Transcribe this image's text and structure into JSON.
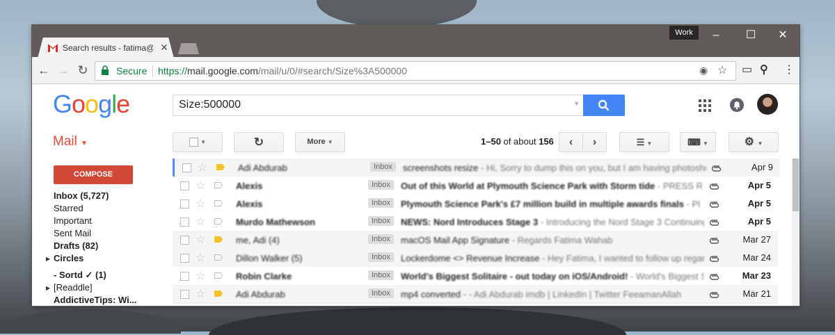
{
  "browser": {
    "profile_badge": "Work",
    "tab_title": "Search results - fatima@",
    "secure_label": "Secure",
    "url_scheme": "https://",
    "url_host": "mail.google.com",
    "url_path": "/mail/u/0/#search/Size%3A500000"
  },
  "gmail": {
    "logo": "Google",
    "search_value": "Size:500000",
    "mail_label": "Mail",
    "compose_label": "COMPOSE",
    "more_label": "More",
    "pager_range": "1–50",
    "pager_of": "of about",
    "pager_total": "156"
  },
  "sidebar": {
    "items": [
      {
        "label": "Inbox (5,727)",
        "bold": true
      },
      {
        "label": "Starred",
        "bold": false
      },
      {
        "label": "Important",
        "bold": false
      },
      {
        "label": "Sent Mail",
        "bold": false
      },
      {
        "label": "Drafts (82)",
        "bold": true
      },
      {
        "label": "Circles",
        "bold": true
      },
      {
        "label": "- Sortd ✓ (1)",
        "bold": true
      },
      {
        "label": "[Readdle]",
        "bold": false
      },
      {
        "label": "AddictiveTips: Wi...",
        "bold": true
      }
    ]
  },
  "emails": [
    {
      "sender": "Adi Abdurab",
      "label": "Inbox",
      "subject": "screenshots resize",
      "snippet": " - Hi, Sorry to dump this on you, but I am having photosho",
      "date": "Apr 9",
      "unread": false,
      "important": true
    },
    {
      "sender": "Alexis",
      "label": "Inbox",
      "subject": "Out of this World at Plymouth Science Park with Storm tide",
      "snippet": " - PRESS R",
      "date": "Apr 5",
      "unread": true,
      "important": false
    },
    {
      "sender": "Alexis",
      "label": "Inbox",
      "subject": "Plymouth Science Park's £7 million build in multiple awards finals",
      "snippet": " - Pl",
      "date": "Apr 5",
      "unread": true,
      "important": false
    },
    {
      "sender": "Murdo Mathewson",
      "label": "Inbox",
      "subject": "NEWS: Nord Introduces Stage 3",
      "snippet": " - Introducing the Nord Stage 3 Continuing",
      "date": "Apr 5",
      "unread": true,
      "important": false
    },
    {
      "sender": "me, Adi (4)",
      "label": "Inbox",
      "subject": "macOS Mail App Signature",
      "snippet": " - Regards Fatima Wahab",
      "date": "Mar 27",
      "unread": false,
      "important": true
    },
    {
      "sender": "Dillon Walker (5)",
      "label": "Inbox",
      "subject": "Lockerdome <> Revenue Increase",
      "snippet": " - Hey Fatima, I wanted to follow up regarc",
      "date": "Mar 24",
      "unread": false,
      "important": false
    },
    {
      "sender": "Robin Clarke",
      "label": "Inbox",
      "subject": "World's Biggest Solitaire - out today on iOS/Android!",
      "snippet": " - World's Biggest S",
      "date": "Mar 23",
      "unread": true,
      "important": false
    },
    {
      "sender": "Adi Abdurab",
      "label": "Inbox",
      "subject": "mp4 converted",
      "snippet": " - - Adi Abdurab imdb | LinkedIn | Twitter FeeamanAllah",
      "date": "Mar 21",
      "unread": false,
      "important": true
    }
  ],
  "colors": {
    "accent_blue": "#4285f4",
    "compose_red": "#d14836",
    "important_yellow": "#f6c026"
  }
}
